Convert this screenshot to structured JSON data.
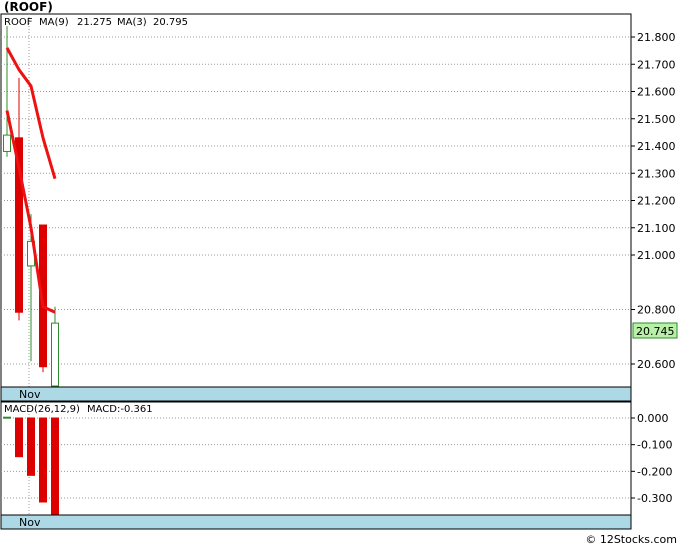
{
  "header": {
    "title": "(ROOF)"
  },
  "legend": {
    "symbol": "ROOF",
    "ma9_label": "MA(9)",
    "ma9_value": "21.275",
    "ma3_label": "MA(3)",
    "ma3_value": "20.795",
    "symbol_color": "#2e8b2e",
    "ma_color": "#2222bb"
  },
  "macd_legend": {
    "label": "MACD(26,12,9)",
    "value_label": "MACD:-0.361"
  },
  "price_tag": "20.745",
  "month_label": "Nov",
  "footer": "© 12Stocks.com",
  "colors": {
    "up": "#2e8b2e",
    "down": "#dd0000",
    "ma": "#ee1111",
    "band": "#add8e6",
    "tag": "#b7f0a6"
  },
  "chart_data": [
    {
      "type": "candlestick",
      "title": "(ROOF)",
      "ylim": [
        20.5,
        21.9
      ],
      "yticks": [
        20.6,
        20.8,
        21.0,
        21.1,
        21.2,
        21.3,
        21.4,
        21.5,
        21.6,
        21.7,
        21.8
      ],
      "ytick_labels": [
        "20.600",
        "20.800",
        "21.000",
        "21.100",
        "21.200",
        "21.300",
        "21.400",
        "21.500",
        "21.600",
        "21.700",
        "21.800"
      ],
      "x_label": "Nov",
      "candles": [
        {
          "open": 21.38,
          "high": 21.84,
          "low": 21.36,
          "close": 21.44
        },
        {
          "open": 21.43,
          "high": 21.65,
          "low": 20.76,
          "close": 20.79
        },
        {
          "open": 20.96,
          "high": 21.15,
          "low": 20.61,
          "close": 21.05
        },
        {
          "open": 21.11,
          "high": 21.11,
          "low": 20.57,
          "close": 20.59
        },
        {
          "open": 20.49,
          "high": 20.81,
          "low": 20.49,
          "close": 20.75
        }
      ],
      "series": [
        {
          "name": "MA(9)",
          "values": [
            21.76,
            21.68,
            21.62,
            21.43,
            21.28
          ]
        },
        {
          "name": "MA(3)",
          "values": [
            21.53,
            21.32,
            21.1,
            20.81,
            20.79
          ]
        }
      ],
      "last_price": 20.745
    },
    {
      "type": "bar",
      "title": "MACD(26,12,9)",
      "ylim": [
        -0.38,
        0.02
      ],
      "yticks": [
        0.0,
        -0.1,
        -0.2,
        -0.3
      ],
      "ytick_labels": [
        "0.000",
        "-0.100",
        "-0.200",
        "-0.300"
      ],
      "x_label": "Nov",
      "values": [
        0.003,
        -0.145,
        -0.215,
        -0.315,
        -0.361
      ]
    }
  ]
}
